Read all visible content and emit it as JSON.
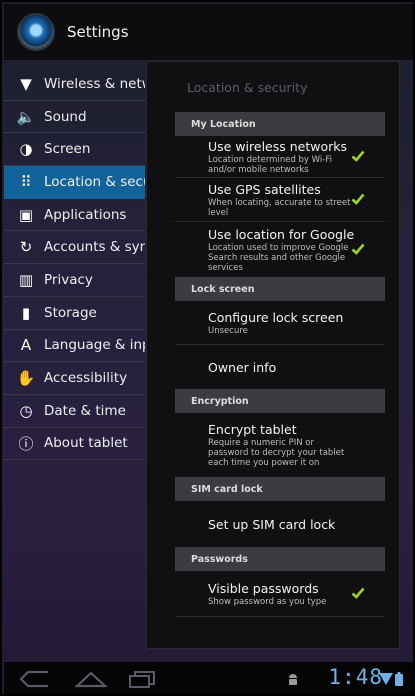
{
  "app": {
    "title": "Settings"
  },
  "nav": {
    "items": [
      {
        "label": "Wireless & netwo",
        "icon": "wifi-icon",
        "glyph": "▼",
        "active": false
      },
      {
        "label": "Sound",
        "icon": "speaker-icon",
        "glyph": "🔈",
        "active": false
      },
      {
        "label": "Screen",
        "icon": "brightness-icon",
        "glyph": "◑",
        "active": false
      },
      {
        "label": "Location & secur",
        "icon": "dots-grid-icon",
        "glyph": "⠿",
        "active": true
      },
      {
        "label": "Applications",
        "icon": "applications-icon",
        "glyph": "▣",
        "active": false
      },
      {
        "label": "Accounts & sync",
        "icon": "sync-icon",
        "glyph": "↻",
        "active": false
      },
      {
        "label": "Privacy",
        "icon": "privacy-icon",
        "glyph": "▥",
        "active": false
      },
      {
        "label": "Storage",
        "icon": "storage-icon",
        "glyph": "▮",
        "active": false
      },
      {
        "label": "Language & inpu",
        "icon": "keyboard-icon",
        "glyph": "A",
        "active": false
      },
      {
        "label": "Accessibility",
        "icon": "hand-icon",
        "glyph": "✋",
        "active": false
      },
      {
        "label": "Date & time",
        "icon": "clock-icon",
        "glyph": "◷",
        "active": false
      },
      {
        "label": "About tablet",
        "icon": "info-icon",
        "glyph": "ⓘ",
        "active": false
      }
    ]
  },
  "panel": {
    "title": "Location & security",
    "sections": {
      "my_location": "My Location",
      "lock_screen": "Lock screen",
      "encryption": "Encryption",
      "sim": "SIM card lock",
      "passwords": "Passwords"
    },
    "prefs": {
      "wireless": {
        "title": "Use wireless networks",
        "summary": "Location determined by Wi-Fi and/or mobile networks",
        "checked": true
      },
      "gps": {
        "title": "Use GPS satellites",
        "summary": "When locating, accurate to street level",
        "checked": true
      },
      "google": {
        "title": "Use location for Google",
        "summary": "Location used to improve Google Search results and other Google services",
        "checked": true
      },
      "configure_lock": {
        "title": "Configure lock screen",
        "summary": "Unsecure"
      },
      "owner": {
        "title": "Owner info"
      },
      "encrypt": {
        "title": "Encrypt tablet",
        "summary": "Require a numeric PIN or password to decrypt your tablet each time you power it on"
      },
      "sim_lock": {
        "title": "Set up SIM card lock"
      },
      "visible_pw": {
        "title": "Visible passwords",
        "summary": "Show password as you type",
        "checked": true
      }
    }
  },
  "status": {
    "clock": "1:48"
  },
  "colors": {
    "accent": "#12639a",
    "check": "#9fd620",
    "clock": "#6fb0e8"
  }
}
